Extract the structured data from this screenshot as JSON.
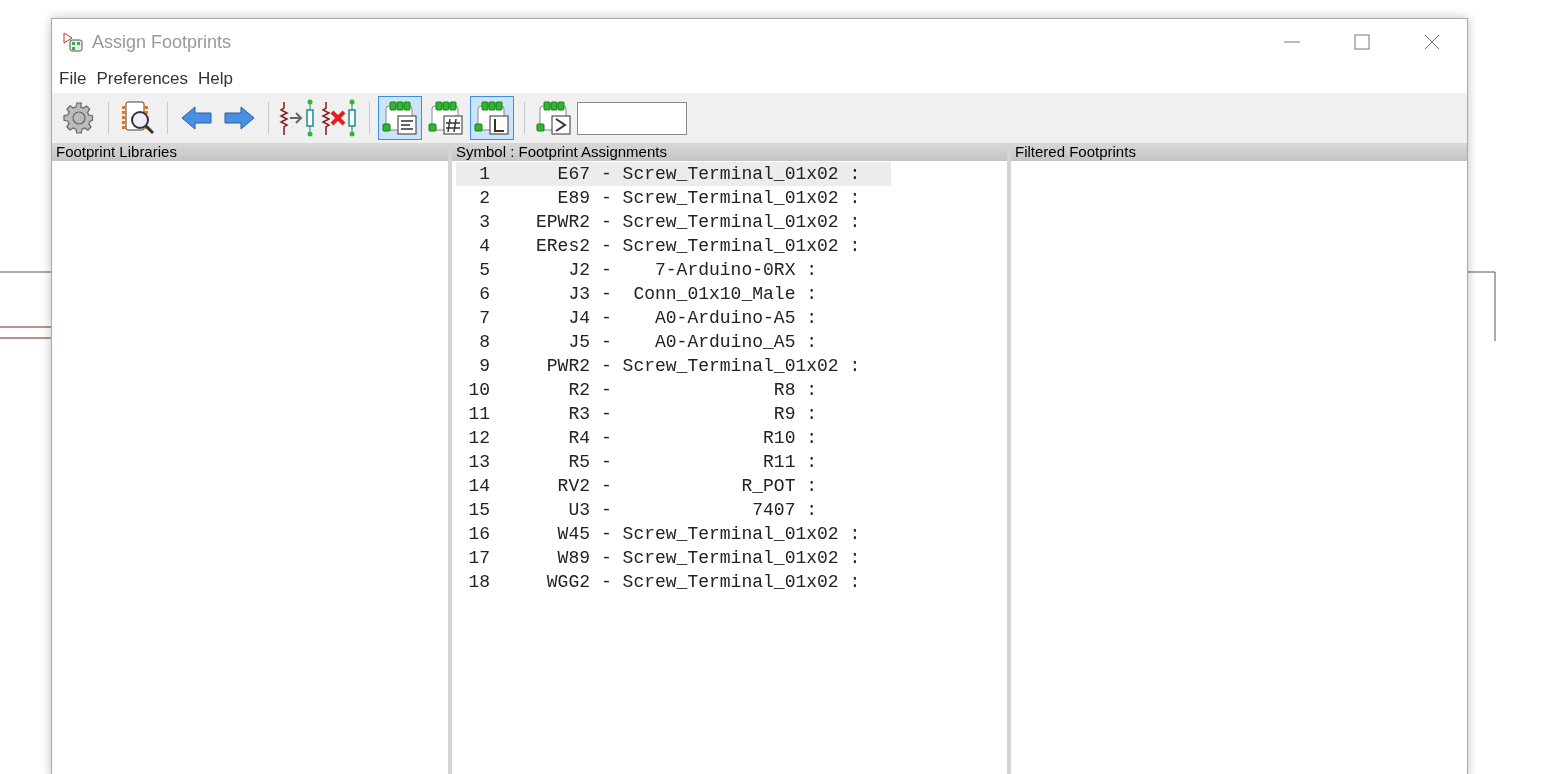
{
  "window": {
    "title": "Assign Footprints"
  },
  "menu": [
    "File",
    "Preferences",
    "Help"
  ],
  "toolbar": {
    "filters": [
      {
        "kind": "description",
        "selected": true
      },
      {
        "kind": "pincount",
        "selected": false
      },
      {
        "kind": "library",
        "selected": true
      }
    ]
  },
  "panels": {
    "libraries": {
      "title": "Footprint Libraries"
    },
    "assignments": {
      "title": "Symbol : Footprint Assignments"
    },
    "filtered": {
      "title": "Filtered Footprints"
    }
  },
  "rows": [
    {
      "num": "1",
      "ref": "E67",
      "assignment": "- Screw_Terminal_01x02 :",
      "selected": true
    },
    {
      "num": "2",
      "ref": "E89",
      "assignment": "- Screw_Terminal_01x02 :",
      "selected": false
    },
    {
      "num": "3",
      "ref": "EPWR2",
      "assignment": "- Screw_Terminal_01x02 :",
      "selected": false
    },
    {
      "num": "4",
      "ref": "ERes2",
      "assignment": "- Screw_Terminal_01x02 :",
      "selected": false
    },
    {
      "num": "5",
      "ref": "J2",
      "assignment": "-    7-Arduino-0RX :",
      "selected": false
    },
    {
      "num": "6",
      "ref": "J3",
      "assignment": "-  Conn_01x10_Male :",
      "selected": false
    },
    {
      "num": "7",
      "ref": "J4",
      "assignment": "-    A0-Arduino-A5 :",
      "selected": false
    },
    {
      "num": "8",
      "ref": "J5",
      "assignment": "-    A0-Arduino_A5 :",
      "selected": false
    },
    {
      "num": "9",
      "ref": "PWR2",
      "assignment": "- Screw_Terminal_01x02 :",
      "selected": false
    },
    {
      "num": "10",
      "ref": "R2",
      "assignment": "-               R8 :",
      "selected": false
    },
    {
      "num": "11",
      "ref": "R3",
      "assignment": "-               R9 :",
      "selected": false
    },
    {
      "num": "12",
      "ref": "R4",
      "assignment": "-              R10 :",
      "selected": false
    },
    {
      "num": "13",
      "ref": "R5",
      "assignment": "-              R11 :",
      "selected": false
    },
    {
      "num": "14",
      "ref": "RV2",
      "assignment": "-            R_POT :",
      "selected": false
    },
    {
      "num": "15",
      "ref": "U3",
      "assignment": "-             7407 :",
      "selected": false
    },
    {
      "num": "16",
      "ref": "W45",
      "assignment": "- Screw_Terminal_01x02 :",
      "selected": false
    },
    {
      "num": "17",
      "ref": "W89",
      "assignment": "- Screw_Terminal_01x02 :",
      "selected": false
    },
    {
      "num": "18",
      "ref": "WGG2",
      "assignment": "- Screw_Terminal_01x02 :",
      "selected": false
    }
  ]
}
